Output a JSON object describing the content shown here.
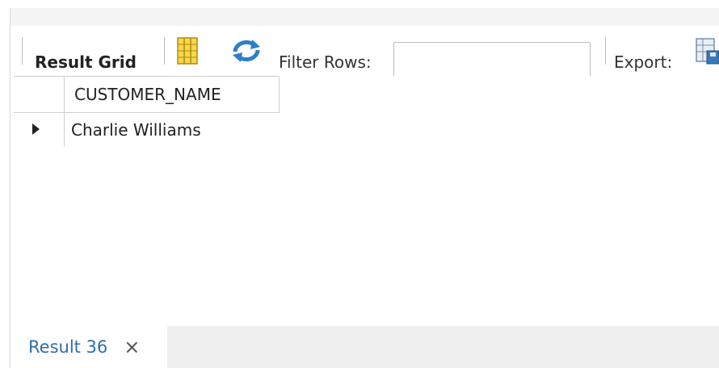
{
  "toolbar": {
    "result_grid_label": "Result Grid",
    "filter_label": "Filter Rows:",
    "filter_value": "",
    "export_label": "Export:"
  },
  "grid": {
    "columns": [
      "CUSTOMER_NAME"
    ],
    "rows": [
      [
        "Charlie Williams"
      ]
    ]
  },
  "tabs": [
    {
      "label": "Result 36",
      "close_glyph": "×"
    }
  ],
  "colors": {
    "tab_text": "#2f6fa8",
    "refresh_icon": "#2f7fc8"
  }
}
